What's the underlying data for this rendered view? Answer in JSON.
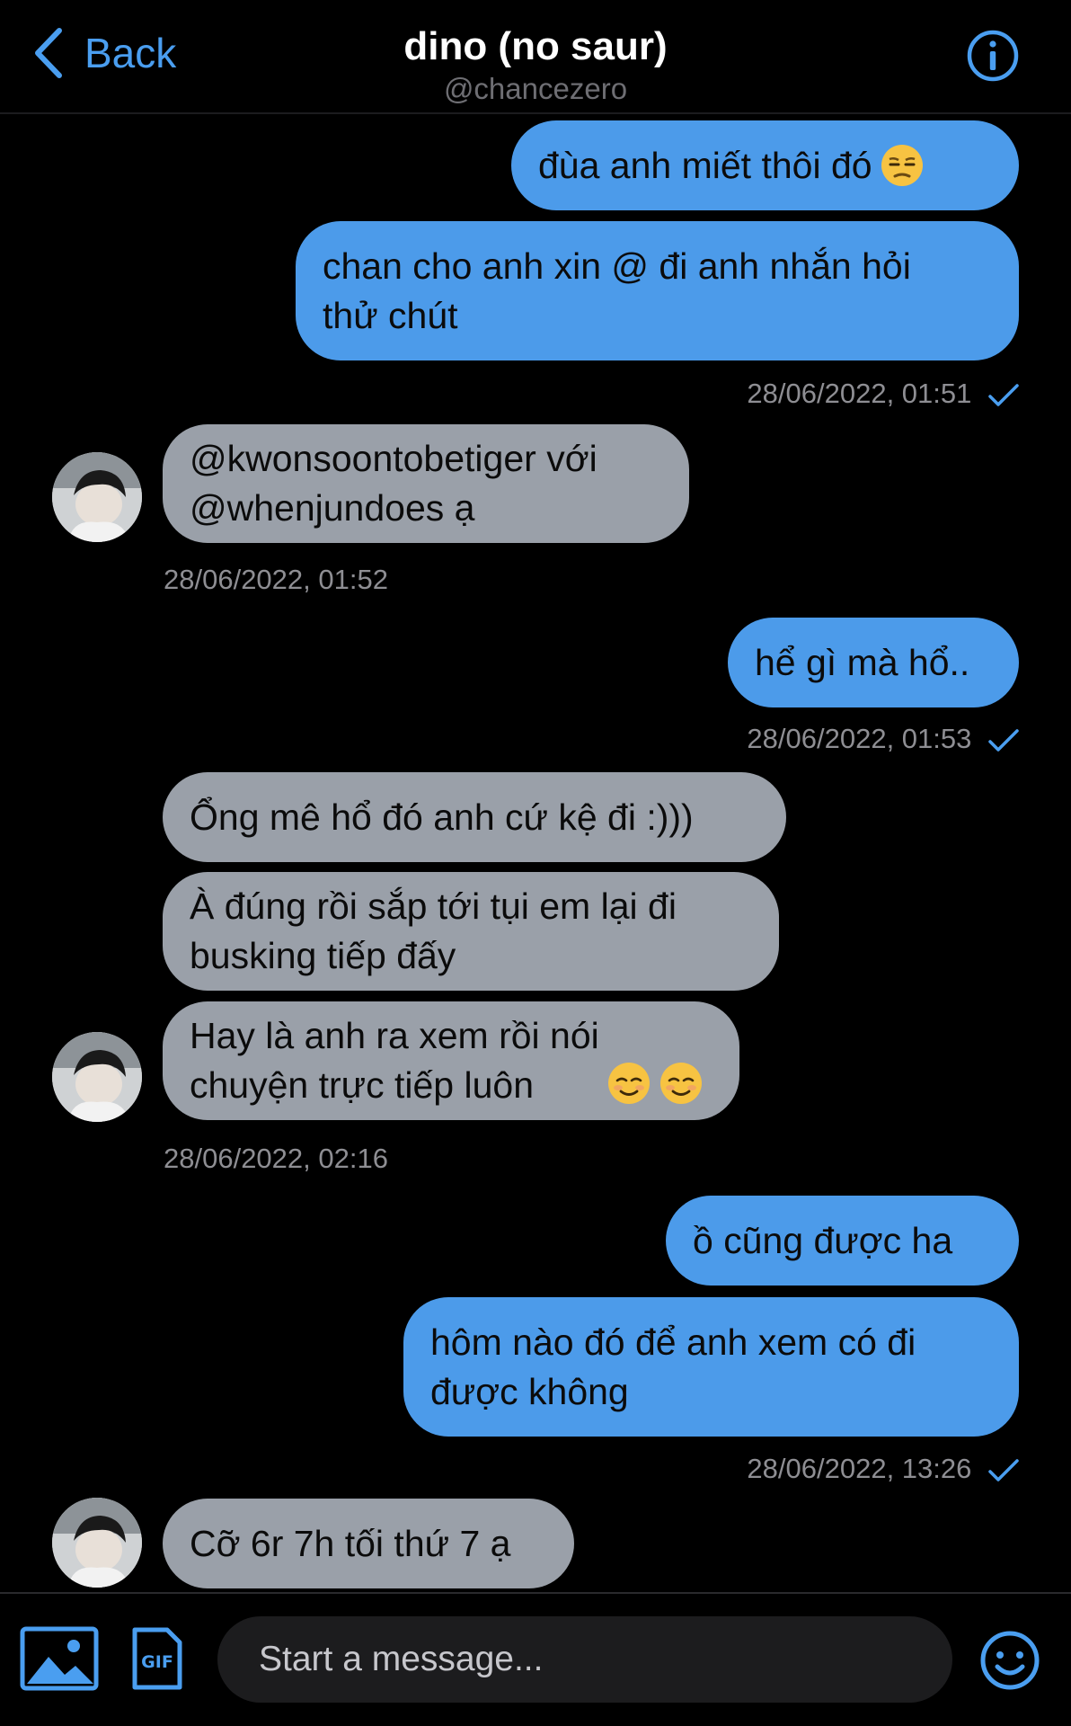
{
  "header": {
    "back_label": "Back",
    "title": "dino (no saur)",
    "handle": "@chancezero"
  },
  "messages": [
    {
      "dir": "out",
      "text": "đùa anh miết thôi đó",
      "emoji": [
        "unamused-face-emoji"
      ]
    },
    {
      "dir": "out",
      "text": "chan cho anh xin @ đi anh nhắn hỏi\nthử chút"
    },
    {
      "dir": "out_ts",
      "text": "28/06/2022, 01:51"
    },
    {
      "dir": "in",
      "text": "@kwonsoontobetiger với\n@whenjundoes ạ"
    },
    {
      "dir": "in_ts",
      "text": "28/06/2022, 01:52"
    },
    {
      "dir": "out",
      "text": "hể gì mà hổ.."
    },
    {
      "dir": "out_ts",
      "text": "28/06/2022, 01:53"
    },
    {
      "dir": "in",
      "text": "Ổng mê hổ đó anh cứ kệ đi :)))"
    },
    {
      "dir": "in",
      "text": "À đúng rồi sắp tới tụi em lại đi\nbusking tiếp đấy"
    },
    {
      "dir": "in",
      "text": "Hay là anh ra xem rồi nói\nchuyện trực tiếp luôn",
      "emoji": [
        "smiling-face-emoji",
        "smiling-face-emoji"
      ]
    },
    {
      "dir": "in_ts",
      "text": "28/06/2022, 02:16"
    },
    {
      "dir": "out",
      "text": "ồ cũng được ha"
    },
    {
      "dir": "out",
      "text": "hôm nào đó để anh xem có đi\nđược không"
    },
    {
      "dir": "out_ts",
      "text": "28/06/2022, 13:26"
    },
    {
      "dir": "in",
      "text": "Cỡ 6r 7h tối thứ 7 ạ"
    }
  ],
  "composer": {
    "placeholder": "Start a message...",
    "media_icon": "image-icon",
    "gif_label": "GIF",
    "emoji_icon": "emoji-icon"
  },
  "colors": {
    "accent": "#4a9ef0",
    "outgoing_bubble": "#4c9bea",
    "incoming_bubble": "#9aa0a9",
    "background": "#000000"
  }
}
